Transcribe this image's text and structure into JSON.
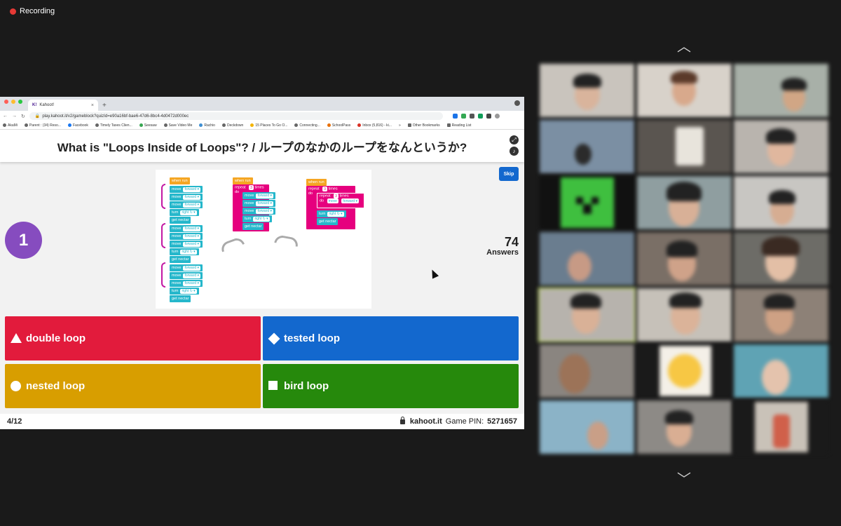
{
  "recording": {
    "label": "Recording"
  },
  "browser": {
    "tab_title": "Kahoot!",
    "new_tab": "+",
    "url": "play.kahoot.it/v2/gameblock?quizId=e90a16bf-bae6-47d6-8bc4-4d0472d000ec",
    "bookmarks": [
      "AkaMi",
      "Parent : (34) Reso...",
      "Facebook",
      "Timely Taxes Clien...",
      "Seesaw",
      "Save Video Me",
      "Rachio",
      "Deckdown",
      "15 Places To Go O...",
      "Connecting...",
      "SchoolPass",
      "Inbox (5,816) - ki...",
      "»",
      "Other Bookmarks",
      "Reading List"
    ]
  },
  "kahoot": {
    "question": "What is \"Loops Inside of Loops\"? / ループのなかのループをなんというか?",
    "timer": "1",
    "skip_label": "Skip",
    "answers_count": "74",
    "answers_label": "Answers",
    "options": [
      {
        "label": "double loop",
        "shape": "triangle-icon",
        "color": "#e21b3c"
      },
      {
        "label": "tested loop",
        "shape": "diamond-icon",
        "color": "#1368ce"
      },
      {
        "label": "nested loop",
        "shape": "circle-icon",
        "color": "#d89e00"
      },
      {
        "label": "bird loop",
        "shape": "square-icon",
        "color": "#26890c"
      }
    ],
    "progress": "4/12",
    "site": "kahoot.it",
    "pin_label": "Game PIN:",
    "pin": "5271657",
    "code": {
      "when_run": "when run",
      "move": "move",
      "forward": "forward ▾",
      "turn": "turn",
      "right": "right ↻ ▾",
      "get_nectar": "get nectar",
      "repeat": "repeat",
      "repeat_count": "3",
      "times": "times",
      "do": "do"
    }
  },
  "gallery": {
    "up_chevron": "︿",
    "down_chevron": "﹀"
  }
}
